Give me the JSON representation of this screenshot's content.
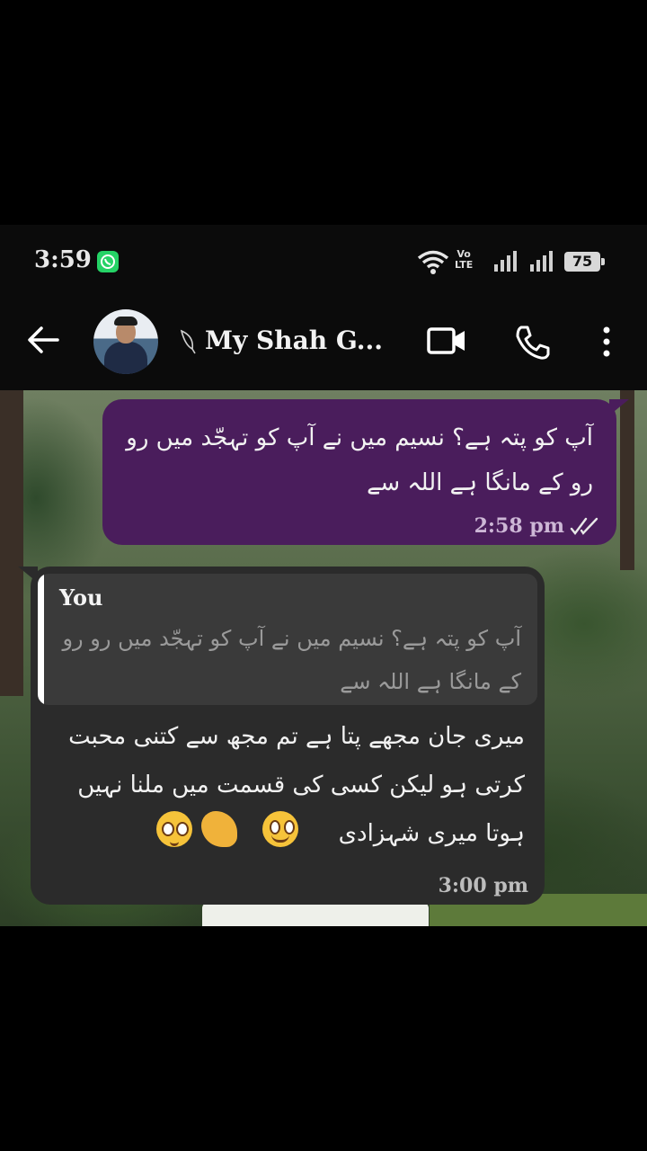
{
  "status_bar": {
    "time": "3:59",
    "volte_top": "Vo",
    "volte_bottom": "LTE",
    "battery": "75"
  },
  "header": {
    "contact_name": "My Shah G..."
  },
  "messages": {
    "outgoing": {
      "text": "آپ کو پتہ ہے؟ نسیم  میں نے آپ کو تہجّد میں رو رو کے مانگا ہے اللہ سے",
      "time": "2:58 pm",
      "status_icon": "double-check-icon"
    },
    "incoming": {
      "quoted_author": "You",
      "quoted_text": "آپ کو پتہ ہے؟ نسیم  میں نے آپ کو تہجّد میں رو رو کے مانگا ہے اللہ سے",
      "text": "میری جان مجھے پتا ہے تم مجھ سے کتنی محبت کرتی ہو لیکن کسی کی قسمت میں ملنا نہیں ہوتا میری شہزادی",
      "emojis": [
        "pleading-face-icon",
        "pinched-fingers-icon",
        "smiling-face-with-tear-icon"
      ],
      "time": "3:00 pm"
    }
  },
  "colors": {
    "outgoing_bubble": "#4a1d5c",
    "incoming_bubble": "#2b2b2b",
    "whatsapp_green": "#25d366"
  }
}
